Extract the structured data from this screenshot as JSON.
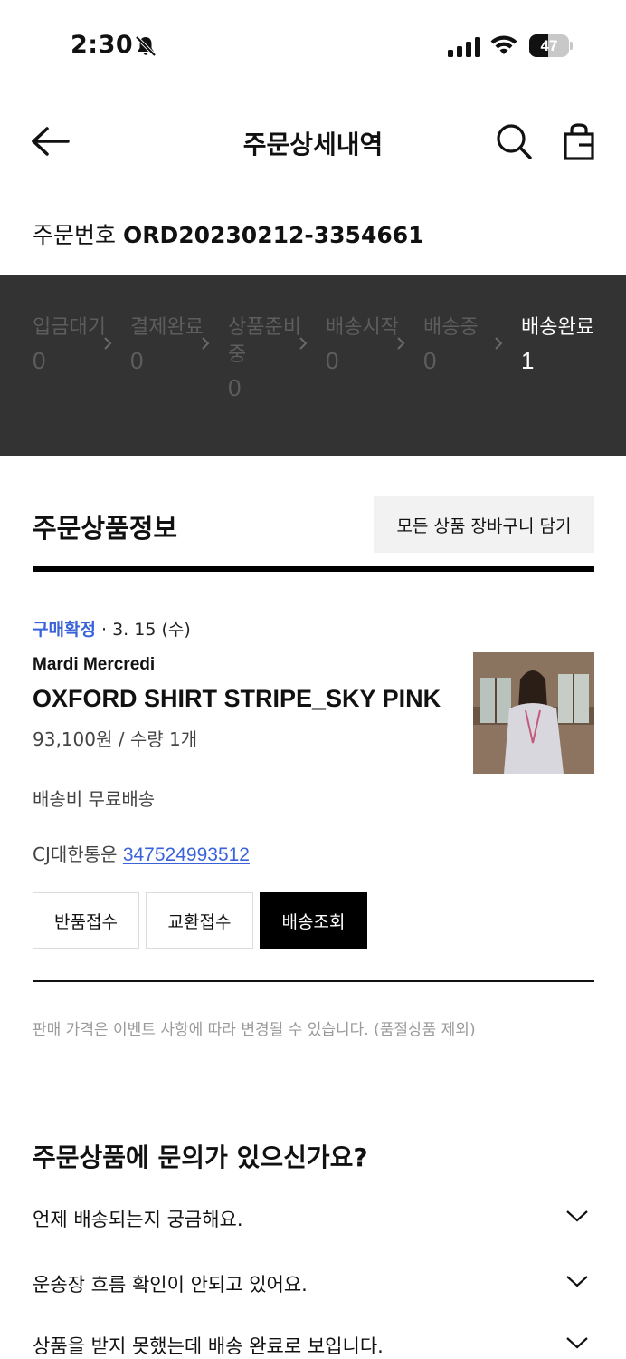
{
  "status_bar": {
    "time": "2:30",
    "battery": "47",
    "battery_level": 0.47
  },
  "nav": {
    "title": "주문상세내역"
  },
  "order": {
    "label": "주문번호",
    "number": "ORD20230212-3354661"
  },
  "progress": {
    "steps": [
      {
        "label": "입금대기",
        "count": "0",
        "active": false
      },
      {
        "label": "결제완료",
        "count": "0",
        "active": false
      },
      {
        "label": "상품준비중",
        "count": "0",
        "active": false
      },
      {
        "label": "배송시작",
        "count": "0",
        "active": false
      },
      {
        "label": "배송중",
        "count": "0",
        "active": false
      },
      {
        "label": "배송완료",
        "count": "1",
        "active": true
      }
    ]
  },
  "section": {
    "title": "주문상품정보",
    "cart_all_label": "모든 상품 장바구니 담기"
  },
  "product": {
    "status": "구매확정",
    "date": "3. 15 (수)",
    "brand": "Mardi Mercredi",
    "name": "OXFORD SHIRT STRIPE_SKY PINK",
    "price_qty": "93,100원 / 수량 1개",
    "shipping_fee": "배송비 무료배송",
    "courier": "CJ대한통운",
    "tracking_number": "347524993512"
  },
  "actions": {
    "return_label": "반품접수",
    "exchange_label": "교환접수",
    "tracking_label": "배송조회"
  },
  "notice": "판매 가격은 이벤트 사항에 따라 변경될 수 있습니다. (품절상품 제외)",
  "faq": {
    "title": "주문상품에 문의가 있으신가요?",
    "items": [
      "언제 배송되는지 궁금해요.",
      "운송장 흐름 확인이 안되고 있어요.",
      "상품을 받지 못했는데 배송 완료로 보입니다."
    ]
  },
  "colors": {
    "accent": "#3a63d9",
    "progress_bg": "#333333",
    "inactive_step": "#5d5d5d"
  }
}
